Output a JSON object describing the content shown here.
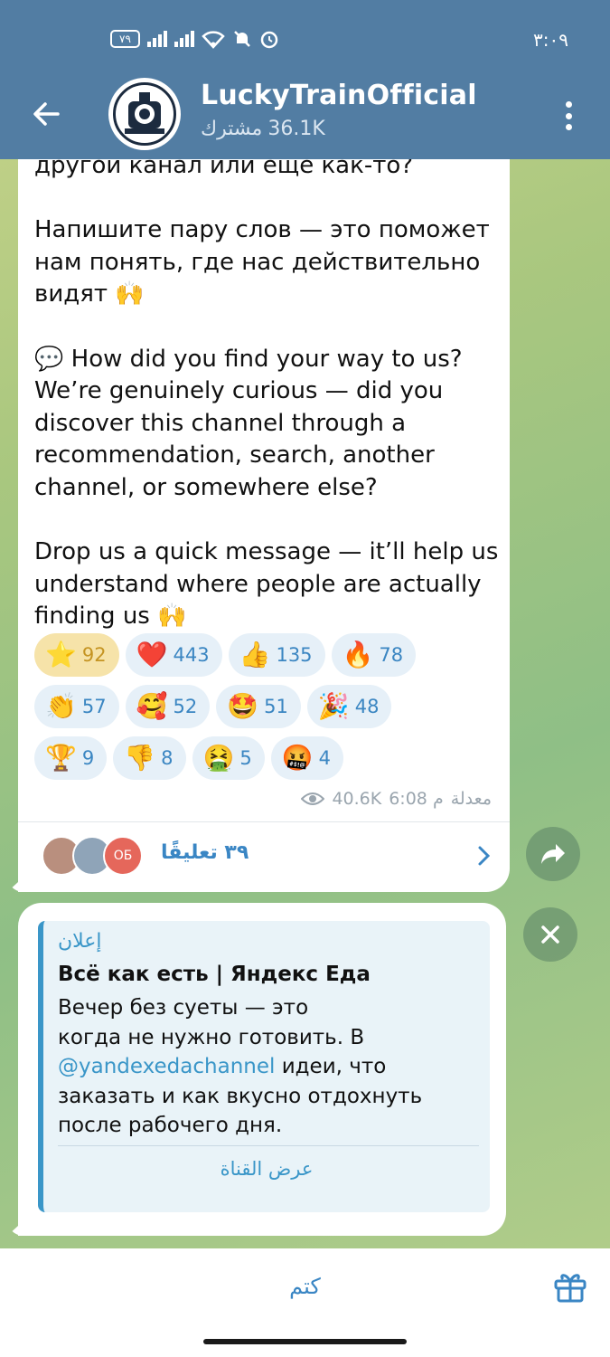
{
  "status_bar": {
    "sim_badge": "٧٩",
    "time": "٣:٠٩"
  },
  "header": {
    "title": "LuckyTrainOfficial",
    "subscribers_count": "36.1K",
    "subscribers_label": "مشترك"
  },
  "message": {
    "text": "другой канал или ещё как-то?\n\nНапишите пару слов — это поможет нам понять, где нас действительно видят 🙌\n\n💬 How did you find your way to us? We’re genuinely curious — did you discover this channel through a recommendation, search, another channel, or somewhere else?\n\nDrop us a quick message — it’ll help us understand where people are actually finding us 🙌",
    "reactions": [
      [
        {
          "emoji": "⭐",
          "count": "92",
          "active": true
        },
        {
          "emoji": "❤️",
          "count": "443"
        },
        {
          "emoji": "👍",
          "count": "135"
        },
        {
          "emoji": "🔥",
          "count": "78"
        }
      ],
      [
        {
          "emoji": "👏",
          "count": "57"
        },
        {
          "emoji": "🥰",
          "count": "52"
        },
        {
          "emoji": "🤩",
          "count": "51"
        },
        {
          "emoji": "🎉",
          "count": "48"
        }
      ],
      [
        {
          "emoji": "🏆",
          "count": "9"
        },
        {
          "emoji": "👎",
          "count": "8"
        },
        {
          "emoji": "🤮",
          "count": "5"
        },
        {
          "emoji": "🤬",
          "count": "4"
        }
      ]
    ],
    "edited_label": "معدلة",
    "time": "6:08 م",
    "views": "40.6K",
    "comments_label": "٣٩ تعليقًا",
    "commenter_initials": "ОБ"
  },
  "ad": {
    "label": "إعلان",
    "title": "Всё как есть | Яндекс Еда",
    "body_before_link": "Вечер без суеты — это\nкогда не нужно готовить. В\n",
    "link": "@yandexedachannel",
    "body_after_link": " идеи, что\nзаказать и как вкусно отдохнуть\nпосле рабочего дня.",
    "action": "عرض القناة"
  },
  "bottom": {
    "mute_label": "كتم"
  },
  "colors": {
    "header": "#527da3",
    "accent": "#3a86c4",
    "active_reaction": "#f6e3a9"
  }
}
